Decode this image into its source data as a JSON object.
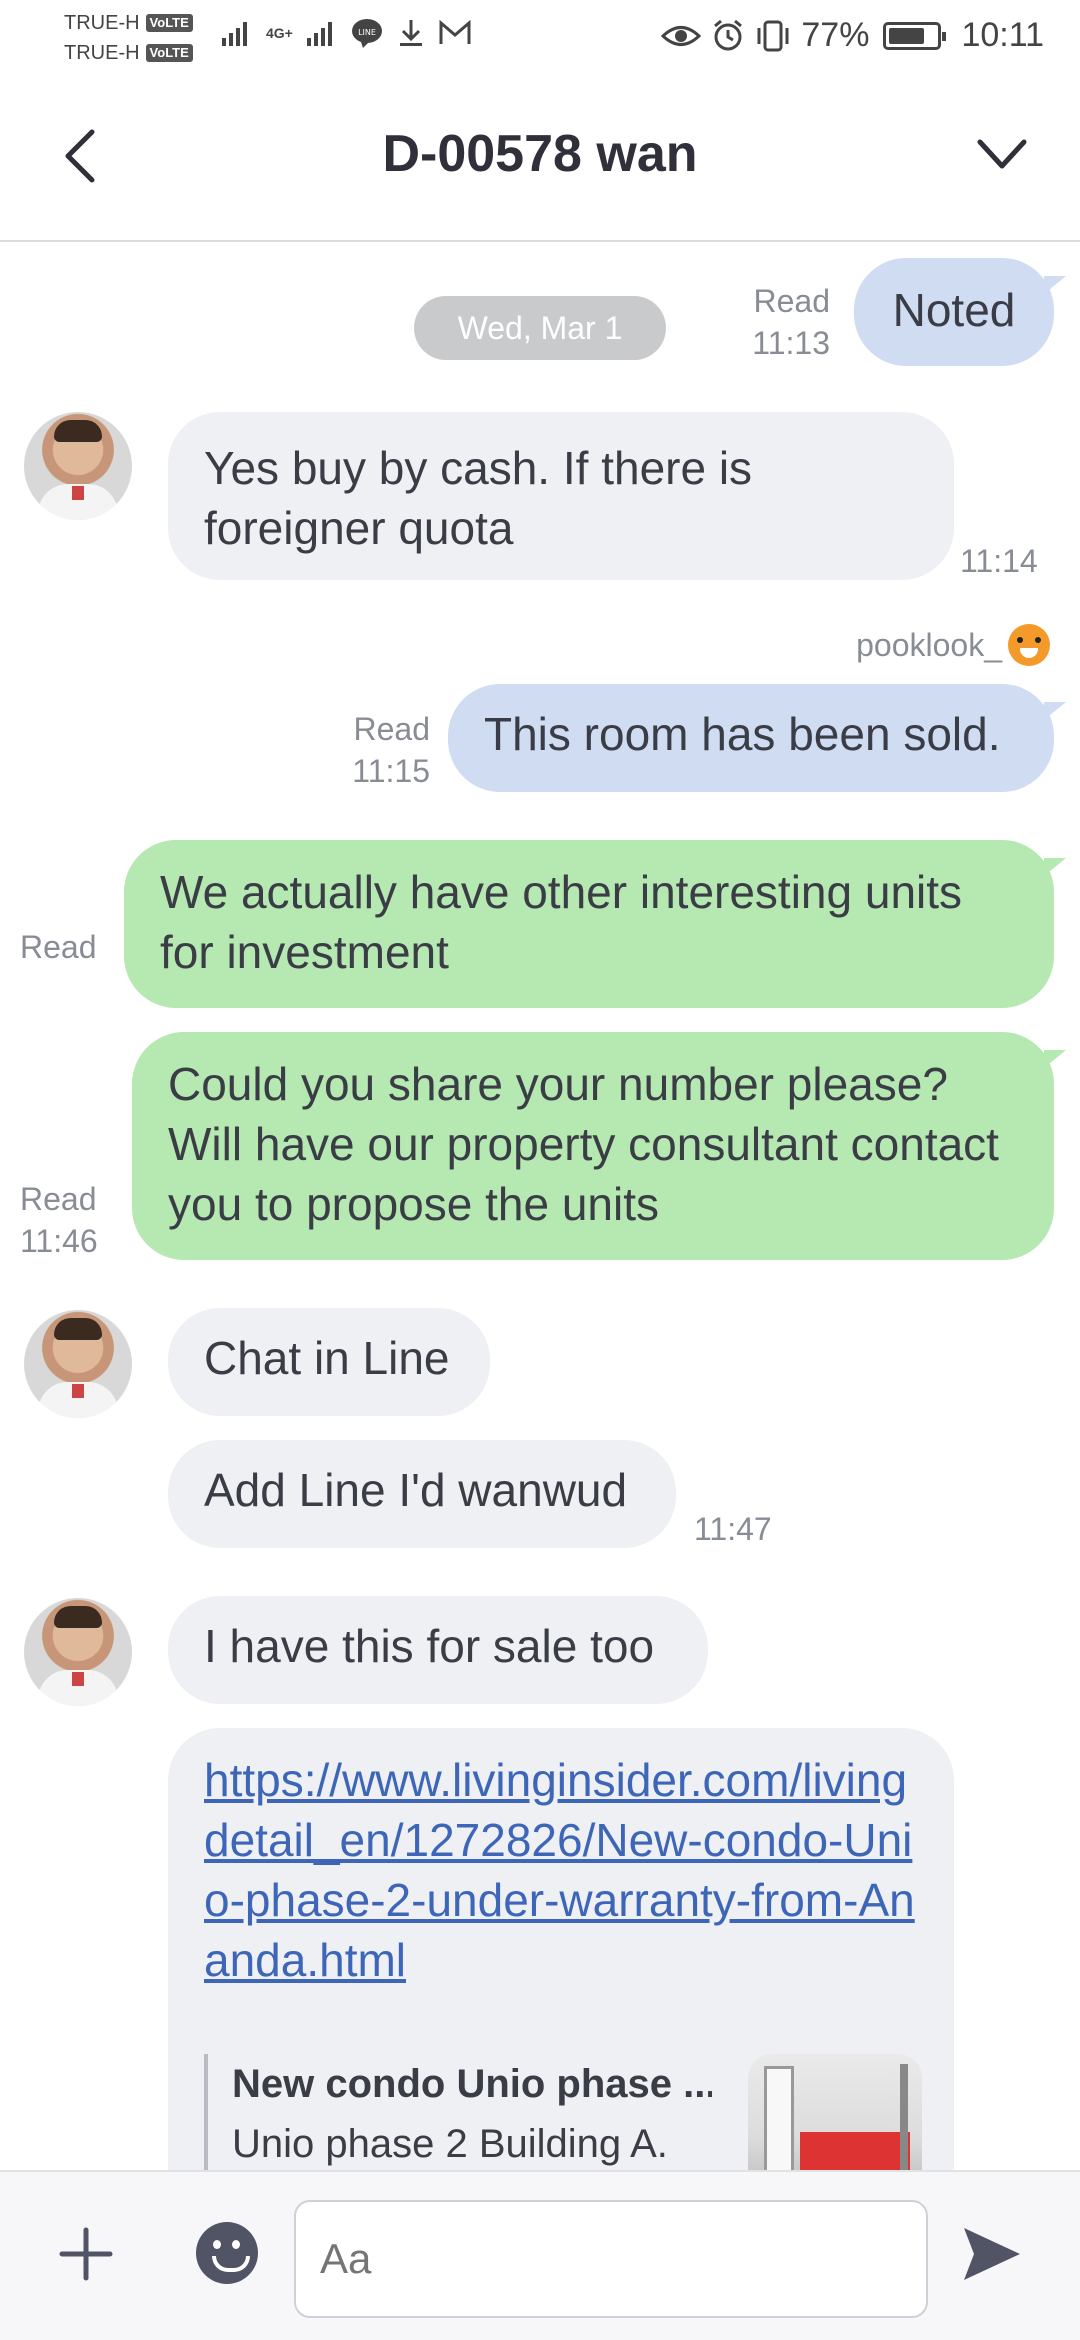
{
  "status_bar": {
    "carrier_1": "TRUE-H",
    "carrier_2": "TRUE-H",
    "volte": "VoLTE",
    "network": "4G+",
    "battery_percent": "77%",
    "battery_level": 0.77,
    "time": "10:11"
  },
  "header": {
    "title": "D-00578 wan"
  },
  "chat": {
    "date_separator": "Wed, Mar 1",
    "messages": [
      {
        "text": "Noted",
        "direction": "out",
        "status": "Read",
        "time": "11:13"
      },
      {
        "text": "Yes buy by cash. If there is foreigner quota",
        "direction": "in",
        "time": "11:14"
      },
      {
        "sender": "pooklook_",
        "text": "This room has been sold.",
        "direction": "out",
        "status": "Read",
        "time": "11:15"
      },
      {
        "text": "We actually have other interesting units for investment",
        "direction": "out",
        "status": "Read"
      },
      {
        "text": "Could you share your number please? Will have our property consultant contact you to propose the units",
        "direction": "out",
        "status": "Read",
        "time": "11:46"
      },
      {
        "text": "Chat in Line",
        "direction": "in"
      },
      {
        "text": "Add Line I'd wanwud",
        "direction": "in",
        "time": "11:47"
      },
      {
        "text": "I have this for sale too",
        "direction": "in"
      },
      {
        "link": "https://www.livinginsider.com/livingdetail_en/1272826/New-condo-Unio-phase-2-under-warranty-from-Ananda.html",
        "preview_title": "New condo Unio phase ...",
        "preview_desc": "Unio phase 2 Building A.",
        "direction": "in"
      }
    ]
  },
  "input_bar": {
    "placeholder": "Aa"
  },
  "colors": {
    "incoming_bubble": "#eef0f3",
    "outgoing_bubble": "#cfdcf2",
    "green_bubble": "#b6e8b1",
    "link": "#3e66b8"
  },
  "icons": [
    "back-arrow-icon",
    "chevron-down-icon",
    "plus-icon",
    "emoji-icon",
    "send-icon",
    "eye-icon",
    "alarm-icon",
    "vibrate-icon",
    "battery-icon",
    "line-app-icon",
    "download-icon",
    "gmail-icon",
    "signal-icon"
  ]
}
